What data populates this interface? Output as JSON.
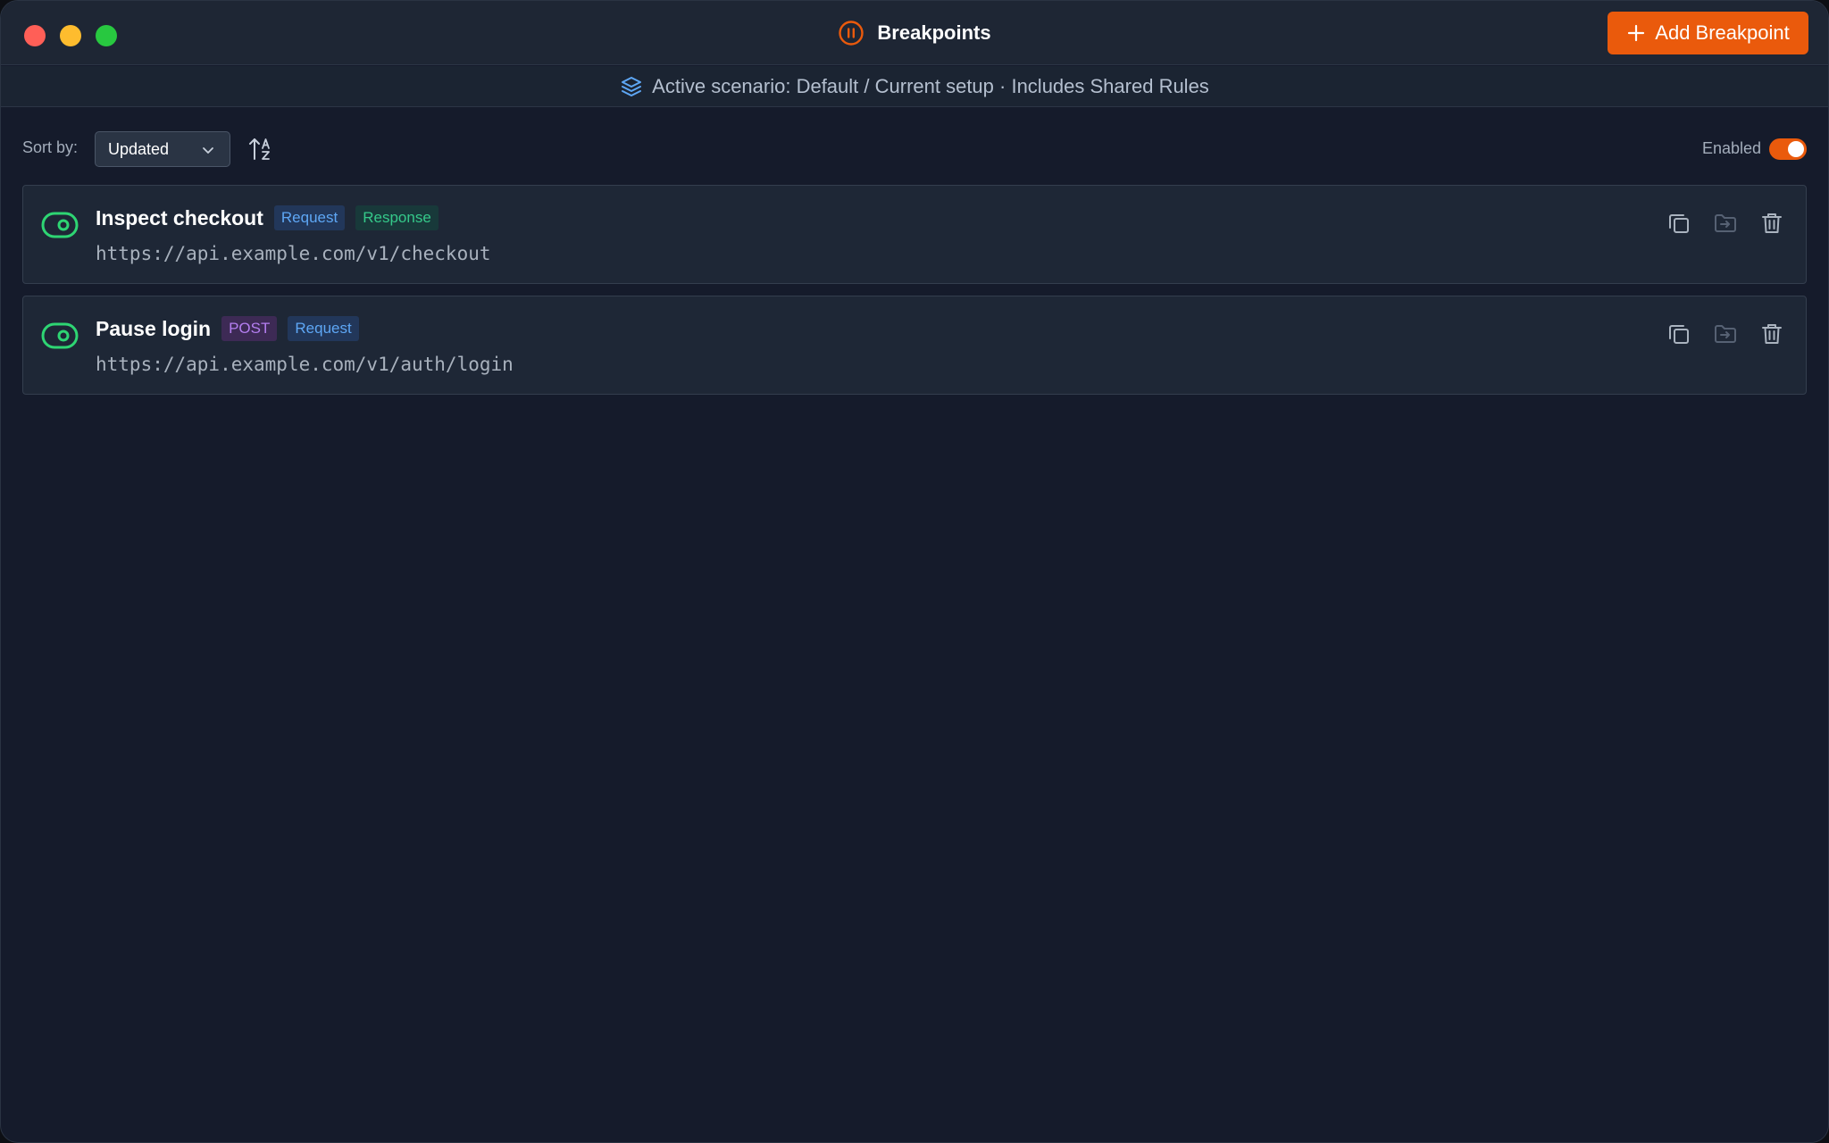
{
  "window": {
    "title": "Breakpoints",
    "add_button_label": "Add Breakpoint"
  },
  "scenario": {
    "text": "Active scenario: Default / Current setup · Includes Shared Rules"
  },
  "toolbar": {
    "sort_label": "Sort by:",
    "sort_value": "Updated",
    "enabled_label": "Enabled",
    "enabled": true
  },
  "breakpoints": [
    {
      "name": "Inspect checkout",
      "badges": [
        "Request",
        "Response"
      ],
      "url": "https://api.example.com/v1/checkout",
      "active": true
    },
    {
      "name": "Pause login",
      "badges": [
        "POST",
        "Request"
      ],
      "url": "https://api.example.com/v1/auth/login",
      "active": true
    }
  ],
  "icons": {
    "title": "pause-circle-icon",
    "add": "plus-icon",
    "scenario": "layers-icon",
    "sort_direction": "sort-ascending-az-icon",
    "row_toggle": "toggle-eye-icon",
    "duplicate": "copy-icon",
    "move": "move-to-folder-icon",
    "delete": "trash-icon"
  },
  "colors": {
    "accent": "#ea5a0c",
    "request_badge": "#5ea7f5",
    "response_badge": "#35c98a",
    "post_badge": "#b47ef0",
    "active_green": "#2ed573",
    "background": "#151b2b"
  }
}
